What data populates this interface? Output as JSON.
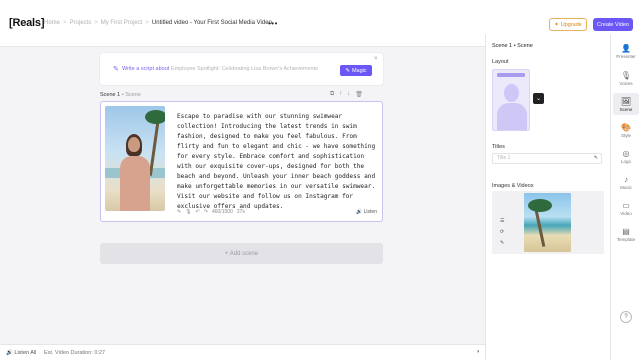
{
  "app": {
    "logo": "[Reals]"
  },
  "breadcrumb": {
    "items": [
      "Home",
      "Projects",
      "My First Project"
    ],
    "current": "Untitled video - Your First Social Media Video",
    "separator": ">",
    "more": "•••"
  },
  "header": {
    "upgrade_label": "Upgrade",
    "create_label": "Create Video"
  },
  "script_generator": {
    "label": "Write a script about",
    "placeholder": "Employee Spotlight: Celebrating Lisa Brown's Achievements",
    "magic_label": "Magic",
    "close": "×"
  },
  "scene": {
    "label": "Scene 1",
    "sublabel": "Scene",
    "script": "Escape to paradise with our stunning swimwear collection! Introducing the latest trends in swim fashion, designed to make you feel fabulous. From flirty and fun to elegant and chic - we have something for every style. Embrace comfort and sophistication with our exquisite cover-ups, designed for both the beach and beyond. Unleash your inner beach goddess and make unforgettable memories in our versatile swimwear. Visit our website and follow us on Instagram for exclusive offers and updates.",
    "char_count": "460/1500",
    "duration": "27s",
    "listen_label": "Listen"
  },
  "add_scene_label": "+ Add scene",
  "footer": {
    "listen_all": "Listen All",
    "estimate": "Est. Video Duration: 0:27"
  },
  "panel": {
    "title": "Scene 1 • Scene",
    "layout_label": "Layout",
    "titles_label": "Titles",
    "title_placeholder": "Title 1",
    "media_label": "Images & Videos"
  },
  "rail": [
    {
      "name": "presenter",
      "label": "Presenter",
      "icon": "👤"
    },
    {
      "name": "voices",
      "label": "Voices",
      "icon": "🎙"
    },
    {
      "name": "scene",
      "label": "Scene",
      "icon": "🖼"
    },
    {
      "name": "style",
      "label": "Style",
      "icon": "🎨"
    },
    {
      "name": "logo",
      "label": "Logo",
      "icon": "◎"
    },
    {
      "name": "music",
      "label": "Music",
      "icon": "♪"
    },
    {
      "name": "video",
      "label": "Video",
      "icon": "▭"
    },
    {
      "name": "template",
      "label": "Template",
      "icon": "▤"
    }
  ],
  "active_rail": "scene",
  "accent_color": "#6a57f5"
}
